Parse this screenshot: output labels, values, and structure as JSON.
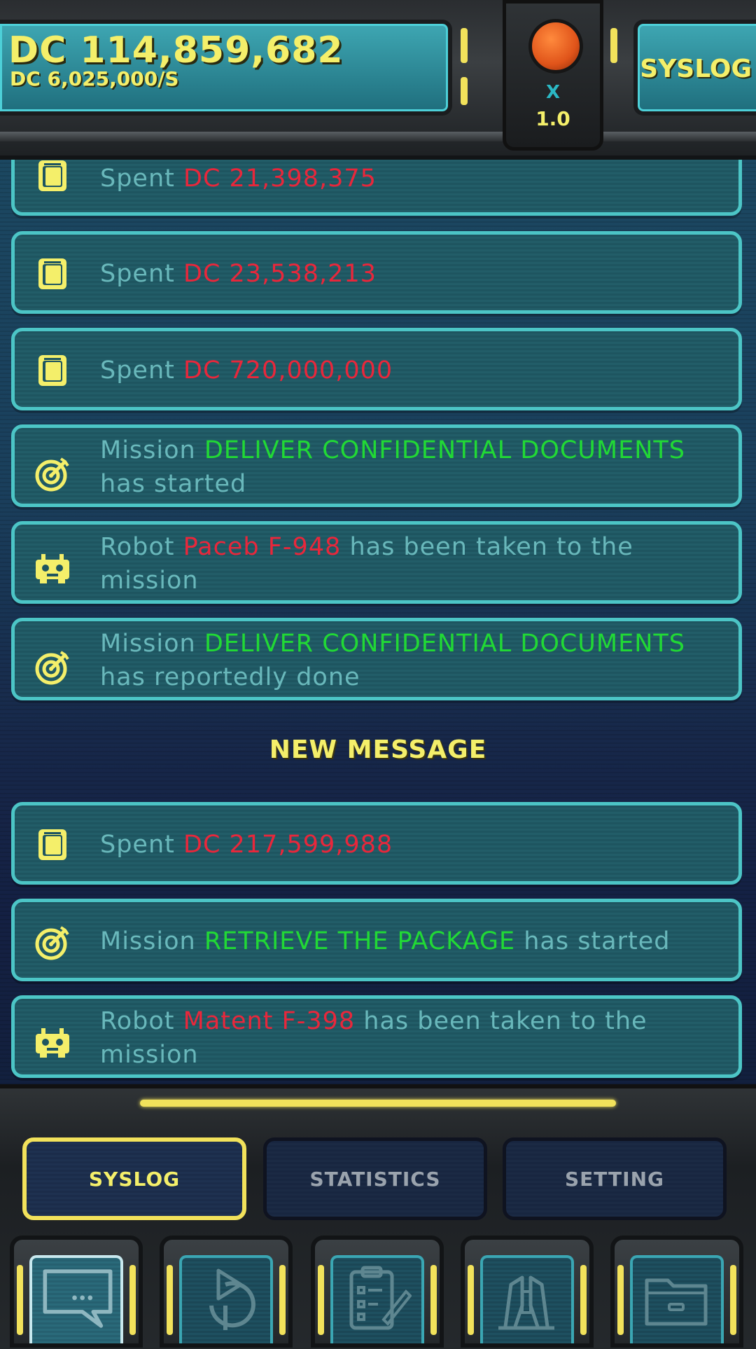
{
  "hud": {
    "money_total": "DC 114,859,682",
    "money_rate": "DC 6,025,000/S",
    "speed_prefix": "X",
    "speed_value": "1.0",
    "panel_title": "SYSLOG"
  },
  "log_entries": [
    {
      "icon": "wallet-icon",
      "parts": [
        "Spent ",
        "DC 21,398,375",
        ""
      ],
      "highlight": "red"
    },
    {
      "icon": "wallet-icon",
      "parts": [
        "Spent ",
        "DC 23,538,213",
        ""
      ],
      "highlight": "red"
    },
    {
      "icon": "wallet-icon",
      "parts": [
        "Spent ",
        "DC 720,000,000",
        ""
      ],
      "highlight": "red"
    },
    {
      "icon": "target-icon",
      "parts": [
        "Mission ",
        "DELIVER CONFIDENTIAL DOCUMENTS",
        " has started"
      ],
      "highlight": "green"
    },
    {
      "icon": "robot-icon",
      "parts": [
        "Robot ",
        "Paceb F-948",
        " has been taken to the mission"
      ],
      "highlight": "red"
    },
    {
      "icon": "target-icon",
      "parts": [
        "Mission ",
        "DELIVER CONFIDENTIAL DOCUMENTS",
        " has reportedly done"
      ],
      "highlight": "green"
    },
    {
      "icon": "wallet-icon",
      "parts": [
        "Spent ",
        "DC 217,599,988",
        ""
      ],
      "highlight": "red"
    },
    {
      "icon": "target-icon",
      "parts": [
        "Mission ",
        "RETRIEVE THE PACKAGE",
        " has started"
      ],
      "highlight": "green"
    },
    {
      "icon": "robot-icon",
      "parts": [
        "Robot ",
        "Matent F-398",
        " has been taken to the mission"
      ],
      "highlight": "red"
    }
  ],
  "new_message_label": "NEW MESSAGE",
  "tabs": [
    {
      "label": "SYSLOG",
      "active": true
    },
    {
      "label": "STATISTICS",
      "active": false
    },
    {
      "label": "SETTING",
      "active": false
    }
  ],
  "nav_buttons": [
    {
      "icon": "chat-icon",
      "active": true
    },
    {
      "icon": "launch-icon",
      "active": false
    },
    {
      "icon": "clipboard-icon",
      "active": false
    },
    {
      "icon": "robot-hangar-icon",
      "active": false
    },
    {
      "icon": "folder-icon",
      "active": false
    }
  ],
  "colors": {
    "accent_yellow": "#f4ef6a",
    "log_text": "#69b8bb",
    "highlight_red": "#e8273b",
    "highlight_green": "#21d935",
    "card_border": "#4cc5c6"
  }
}
